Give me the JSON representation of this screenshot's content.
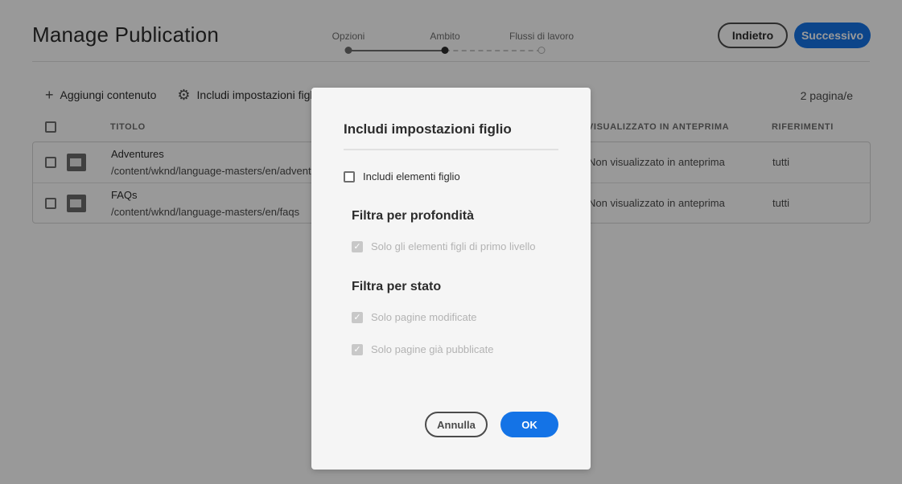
{
  "header": {
    "title": "Manage Publication",
    "back_label": "Indietro",
    "next_label": "Successivo"
  },
  "wizard": {
    "steps": [
      {
        "label": "Opzioni",
        "state": "done"
      },
      {
        "label": "Ambito",
        "state": "current"
      },
      {
        "label": "Flussi di lavoro",
        "state": "future"
      }
    ]
  },
  "toolbar": {
    "add_content": "Aggiungi contenuto",
    "add_icon": "plus-icon",
    "include_children": "Includi impostazioni figlio",
    "include_icon": "gear-icon",
    "page_count": "2 pagina/e"
  },
  "table": {
    "headers": {
      "title": "TITOLO",
      "preview": "VISUALIZZATO IN ANTEPRIMA",
      "references": "RIFERIMENTI"
    },
    "rows": [
      {
        "title": "Adventures",
        "path": "/content/wknd/language-masters/en/advent",
        "preview": "Non visualizzato in anteprima",
        "references": "tutti"
      },
      {
        "title": "FAQs",
        "path": "/content/wknd/language-masters/en/faqs",
        "preview": "Non visualizzato in anteprima",
        "references": "tutti"
      }
    ]
  },
  "dialog": {
    "title": "Includi impostazioni figlio",
    "include_children": "Includi elementi figlio",
    "depth_heading": "Filtra per profondità",
    "depth_first_level": "Solo gli elementi figli di primo livello",
    "status_heading": "Filtra per stato",
    "status_modified": "Solo pagine modificate",
    "status_published": "Solo pagine già pubblicate",
    "cancel_label": "Annulla",
    "ok_label": "OK"
  },
  "colors": {
    "accent": "#1473e6",
    "overlay": "#000000"
  }
}
